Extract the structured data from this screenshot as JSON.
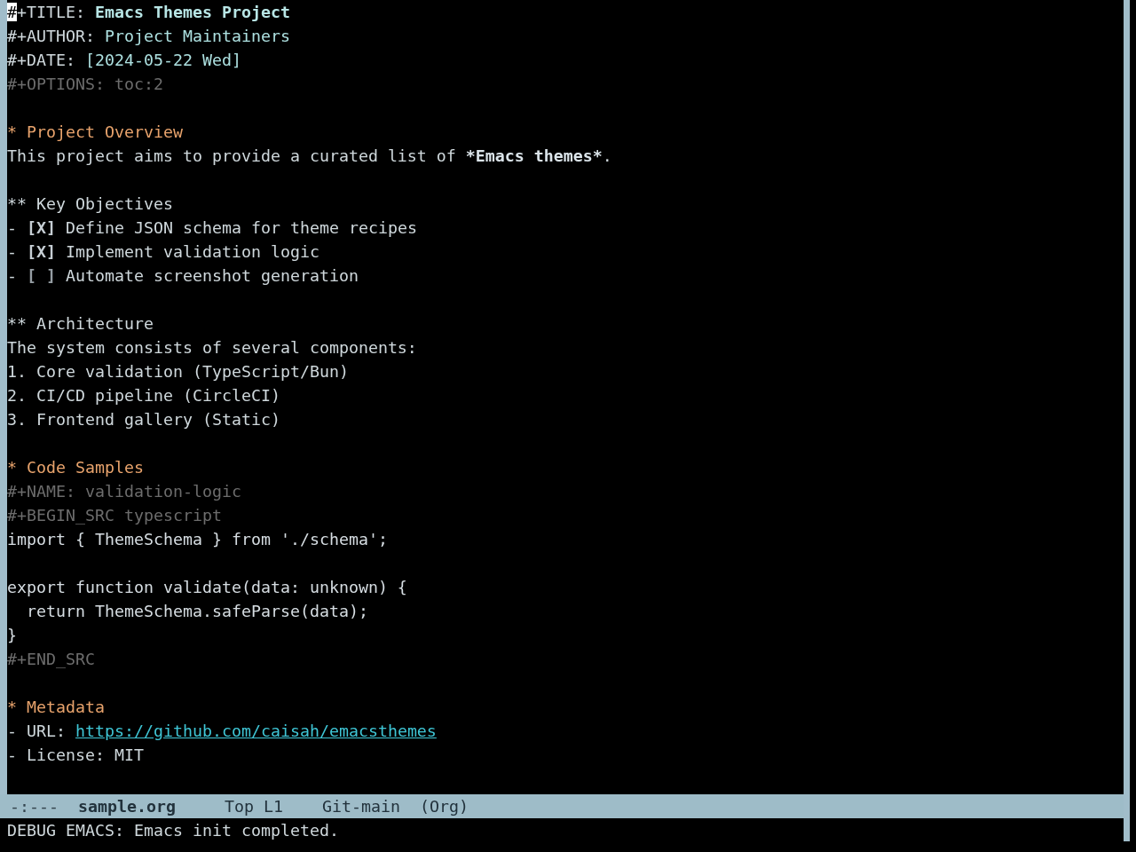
{
  "buffer": {
    "cursor_visible": true,
    "lines": [
      {
        "kind": "keyword",
        "key": "#+TITLE:",
        "value": "Emacs Themes Project",
        "bold": true
      },
      {
        "kind": "keyword",
        "key": "#+AUTHOR:",
        "value": "Project Maintainers",
        "bold": false
      },
      {
        "kind": "keyword",
        "key": "#+DATE:",
        "value": "[2024-05-22 Wed]",
        "bold": false
      },
      {
        "kind": "meta",
        "text": "#+OPTIONS: toc:2"
      },
      {
        "kind": "blank"
      },
      {
        "kind": "heading",
        "text": "* Project Overview"
      },
      {
        "kind": "paragraph",
        "parts": [
          {
            "text": "This project aims to provide a curated list of ",
            "bold": false
          },
          {
            "text": "*Emacs themes*",
            "bold": true
          },
          {
            "text": ".",
            "bold": false
          }
        ]
      },
      {
        "kind": "blank"
      },
      {
        "kind": "subheading",
        "text": "** Key Objectives"
      },
      {
        "kind": "checkbox",
        "bullet": "-",
        "box": "[X]",
        "checked": true,
        "text": "Define JSON schema for theme recipes"
      },
      {
        "kind": "checkbox",
        "bullet": "-",
        "box": "[X]",
        "checked": true,
        "text": "Implement validation logic"
      },
      {
        "kind": "checkbox",
        "bullet": "-",
        "box": "[ ]",
        "checked": false,
        "text": "Automate screenshot generation"
      },
      {
        "kind": "blank"
      },
      {
        "kind": "subheading",
        "text": "** Architecture"
      },
      {
        "kind": "text",
        "text": "The system consists of several components:"
      },
      {
        "kind": "list",
        "text": "1. Core validation (TypeScript/Bun)"
      },
      {
        "kind": "list",
        "text": "2. CI/CD pipeline (CircleCI)"
      },
      {
        "kind": "list",
        "text": "3. Frontend gallery (Static)"
      },
      {
        "kind": "blank"
      },
      {
        "kind": "heading",
        "text": "* Code Samples"
      },
      {
        "kind": "meta",
        "text": "#+NAME: validation-logic"
      },
      {
        "kind": "meta",
        "text": "#+BEGIN_SRC typescript"
      },
      {
        "kind": "code",
        "text": "import { ThemeSchema } from './schema';"
      },
      {
        "kind": "blank"
      },
      {
        "kind": "code",
        "text": "export function validate(data: unknown) {"
      },
      {
        "kind": "code",
        "text": "  return ThemeSchema.safeParse(data);"
      },
      {
        "kind": "code",
        "text": "}"
      },
      {
        "kind": "meta",
        "text": "#+END_SRC"
      },
      {
        "kind": "blank"
      },
      {
        "kind": "heading",
        "text": "* Metadata"
      },
      {
        "kind": "link",
        "label": "- URL:",
        "url": "https://github.com/caisah/emacsthemes"
      },
      {
        "kind": "text",
        "text": "- License: MIT"
      }
    ]
  },
  "mode_line": {
    "status": "-:---",
    "buffer_name": "sample.org",
    "position": "Top L1",
    "branch": "Git-main",
    "mode": "(Org)"
  },
  "echo_area": {
    "message": "DEBUG EMACS: Emacs init completed."
  }
}
